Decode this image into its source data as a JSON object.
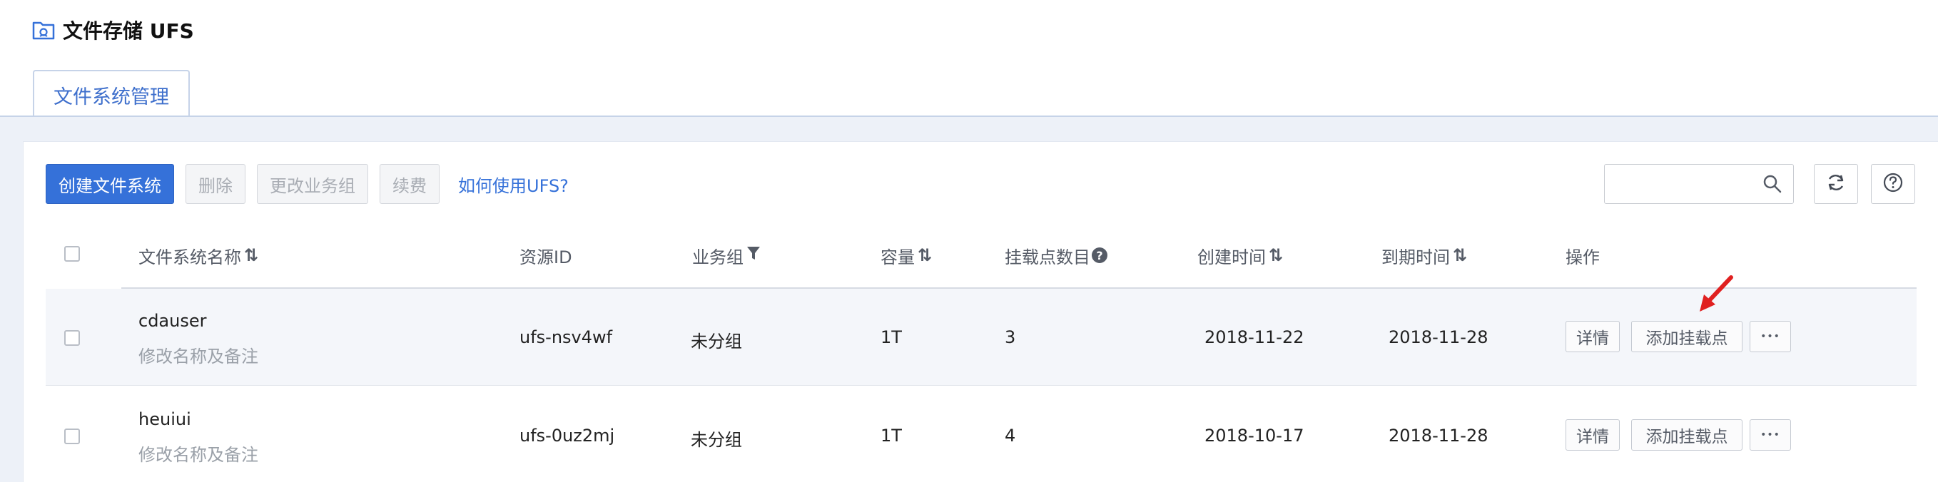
{
  "page": {
    "title": "文件存储 UFS",
    "title_icon": "storage-icon"
  },
  "tabs": [
    {
      "label": "文件系统管理",
      "active": true
    }
  ],
  "toolbar": {
    "create_label": "创建文件系统",
    "delete_label": "删除",
    "change_group_label": "更改业务组",
    "renew_label": "续费",
    "help_link_label": "如何使用UFS?",
    "search_placeholder": "",
    "refresh_icon": "refresh-icon",
    "help_icon": "question-circle-icon"
  },
  "table": {
    "columns": {
      "name": "文件系统名称",
      "resource_id": "资源ID",
      "group": "业务组",
      "capacity": "容量",
      "mount_count": "挂载点数目",
      "created": "创建时间",
      "expires": "到期时间",
      "actions": "操作"
    },
    "rows": [
      {
        "name": "cdauser",
        "note": "修改名称及备注",
        "resource_id": "ufs-nsv4wf",
        "group": "未分组",
        "capacity": "1T",
        "mount_count": "3",
        "created": "2018-11-22",
        "expires": "2018-11-28",
        "detail_label": "详情",
        "add_mount_label": "添加挂载点",
        "more_label": "•••"
      },
      {
        "name": "heuiui",
        "note": "修改名称及备注",
        "resource_id": "ufs-0uz2mj",
        "group": "未分组",
        "capacity": "1T",
        "mount_count": "4",
        "created": "2018-10-17",
        "expires": "2018-11-28",
        "detail_label": "详情",
        "add_mount_label": "添加挂载点",
        "more_label": "•••"
      }
    ]
  },
  "colors": {
    "primary": "#3571d9",
    "annotation_arrow": "#e02020"
  }
}
